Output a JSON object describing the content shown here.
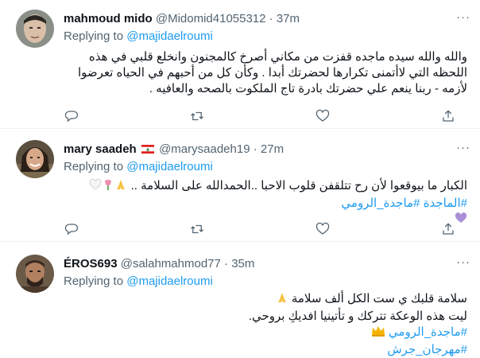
{
  "tweets": [
    {
      "name": "mahmoud mido",
      "handle": "@Midomid41055312",
      "dot": "·",
      "time": "37m",
      "replying_prefix": "Replying to",
      "replying_handle": "@majidaelroumi",
      "lines": [
        "والله والله سيده ماجده قفزت من مكاني أصرخ كالمجنون وانخلع قلبي في هذه",
        "اللحظه التي لاأتمنى تكرارها لحضرتك أبدا . وكأن كل من أحبهم في الحياه تعرضوا",
        "لأزمه - ربنا ينعم علي حضرتك بادرة تاج الملكوت بالصحه والعافيه ."
      ]
    },
    {
      "name": "mary saadeh",
      "handle": "@marysaadeh19",
      "dot": "·",
      "time": "27m",
      "flag": "lebanon-flag",
      "replying_prefix": "Replying to",
      "replying_handle": "@majidaelroumi",
      "line1": "الكبار ما بيوقعوا لأن رح تتلقفن قلوب الاحبا ..الحمدالله على السلامة ..",
      "hashtags": "#الماجدة #ماجدة_الرومي"
    },
    {
      "name": "ÉROS693",
      "handle": "@salahmahmod77",
      "dot": "·",
      "time": "35m",
      "replying_prefix": "Replying to",
      "replying_handle": "@majidaelroumi",
      "line1": "سلامة قلبك ي ست الكل ألف سلامة",
      "line2": "ليت هذه الوعكة تتركك و تأتينيا افديكِ بروحي.",
      "hashtag1": "#ماجدة_الرومي",
      "hashtag2": "#مهرجان_جرش"
    }
  ],
  "colors": {
    "link": "#1d9bf0",
    "secondary": "#536471",
    "border": "#eff3f4"
  },
  "icons": [
    "reply-icon",
    "retweet-icon",
    "like-icon",
    "share-icon",
    "more-icon"
  ]
}
